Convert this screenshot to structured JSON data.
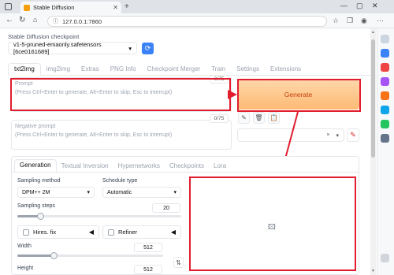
{
  "browser": {
    "tab_title": "Stable Diffusion",
    "url": "127.0.0.1:7860",
    "tab_close": "✕",
    "new_tab": "+",
    "window_controls": [
      "—",
      "▢",
      "✕"
    ]
  },
  "checkpoint": {
    "label": "Stable Diffusion checkpoint",
    "value": "v1-5-pruned-emaonly.safetensors [6ce0161689]"
  },
  "main_tabs": [
    "txt2img",
    "img2img",
    "Extras",
    "PNG Info",
    "Checkpoint Merger",
    "Train",
    "Settings",
    "Extensions"
  ],
  "prompt": {
    "label": "Prompt",
    "placeholder": "(Press Ctrl+Enter to generate, Alt+Enter to skip, Esc to interrupt)",
    "counter": "0/75"
  },
  "negative_prompt": {
    "label": "Negative prompt",
    "placeholder": "(Press Ctrl+Enter to generate, Alt+Enter to skip, Esc to interrupt)",
    "counter": "0/75"
  },
  "generate_label": "Generate",
  "tool_icons": [
    "✎",
    "🗑",
    "📋"
  ],
  "styles": {
    "clear": "×",
    "caret": "▾",
    "edit_icon": "✎"
  },
  "settings_tabs": [
    "Generation",
    "Textual Inversion",
    "Hypernetworks",
    "Checkpoints",
    "Lora"
  ],
  "sampling": {
    "method_label": "Sampling method",
    "method_value": "DPM++ 2M",
    "schedule_label": "Schedule type",
    "schedule_value": "Automatic",
    "steps_label": "Sampling steps",
    "steps_value": "20",
    "steps_fraction": 0.14
  },
  "accordions": {
    "hires_label": "Hires. fix",
    "refiner_label": "Refiner",
    "arrow": "◀"
  },
  "size": {
    "width_label": "Width",
    "width_value": "512",
    "width_fraction": 0.25,
    "height_label": "Height",
    "height_value": "512",
    "swap_icon": "⇅"
  },
  "output": {
    "placeholder_icon": "image-placeholder-icon"
  },
  "highlight_color": "#e11d2e",
  "accent": "#f97316"
}
